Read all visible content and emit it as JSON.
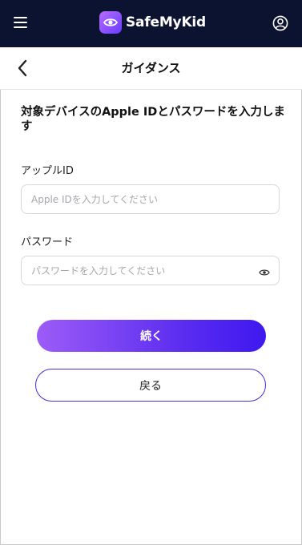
{
  "app": {
    "brand_name": "SafeMyKid"
  },
  "icons": {
    "menu": "hamburger-menu-icon",
    "logo": "eye-shield-logo-icon",
    "account": "user-circle-icon",
    "back": "chevron-left-icon",
    "visibility": "eye-icon"
  },
  "header": {
    "title": "ガイダンス"
  },
  "form": {
    "instruction": "対象デバイスのApple IDとパスワードを入力します",
    "apple_id_label": "アップルID",
    "apple_id_value": "",
    "apple_id_placeholder": "Apple IDを入力してください",
    "password_label": "パスワード",
    "password_value": "",
    "password_placeholder": "パスワードを入力してください"
  },
  "actions": {
    "continue_label": "続く",
    "back_label": "戻る"
  },
  "colors": {
    "topbar": "#0c1330",
    "accent_start": "#9c5cf7",
    "accent_end": "#3e18ef",
    "secondary_border": "#4b2ad6"
  }
}
